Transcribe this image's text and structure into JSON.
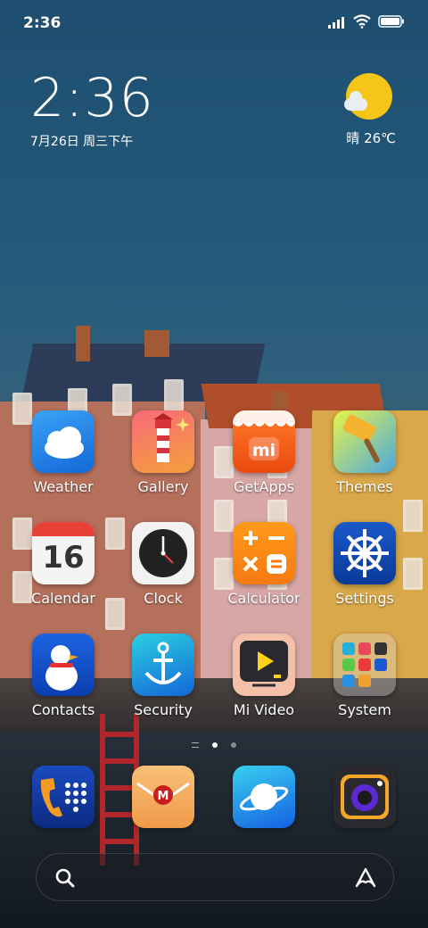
{
  "status_bar": {
    "time": "2:36",
    "icons": [
      "signal-icon",
      "wifi-icon",
      "battery-icon"
    ]
  },
  "clock_widget": {
    "time": "2:36",
    "date": "7月26日 周三下午"
  },
  "weather_widget": {
    "icon": "sun-cloud-icon",
    "text": "晴 26℃"
  },
  "apps": [
    {
      "label": "Weather",
      "icon": "weather-icon"
    },
    {
      "label": "Gallery",
      "icon": "gallery-icon"
    },
    {
      "label": "GetApps",
      "icon": "getapps-icon",
      "glyph": "mi"
    },
    {
      "label": "Themes",
      "icon": "themes-icon"
    },
    {
      "label": "Calendar",
      "icon": "calendar-icon",
      "glyph": "16"
    },
    {
      "label": "Clock",
      "icon": "clock-icon"
    },
    {
      "label": "Calculator",
      "icon": "calculator-icon"
    },
    {
      "label": "Settings",
      "icon": "settings-icon"
    },
    {
      "label": "Contacts",
      "icon": "contacts-icon"
    },
    {
      "label": "Security",
      "icon": "security-icon"
    },
    {
      "label": "Mi Video",
      "icon": "mi-video-icon"
    },
    {
      "label": "System",
      "icon": "system-folder-icon"
    }
  ],
  "dock": [
    {
      "icon": "phone-icon"
    },
    {
      "icon": "messaging-icon",
      "glyph": "M"
    },
    {
      "icon": "browser-icon"
    },
    {
      "icon": "camera-icon"
    }
  ],
  "page_indicator": {
    "pages": 2,
    "current": 1
  },
  "search_bar": {
    "left_icon": "search-icon",
    "right_icon": "assistant-icon"
  }
}
